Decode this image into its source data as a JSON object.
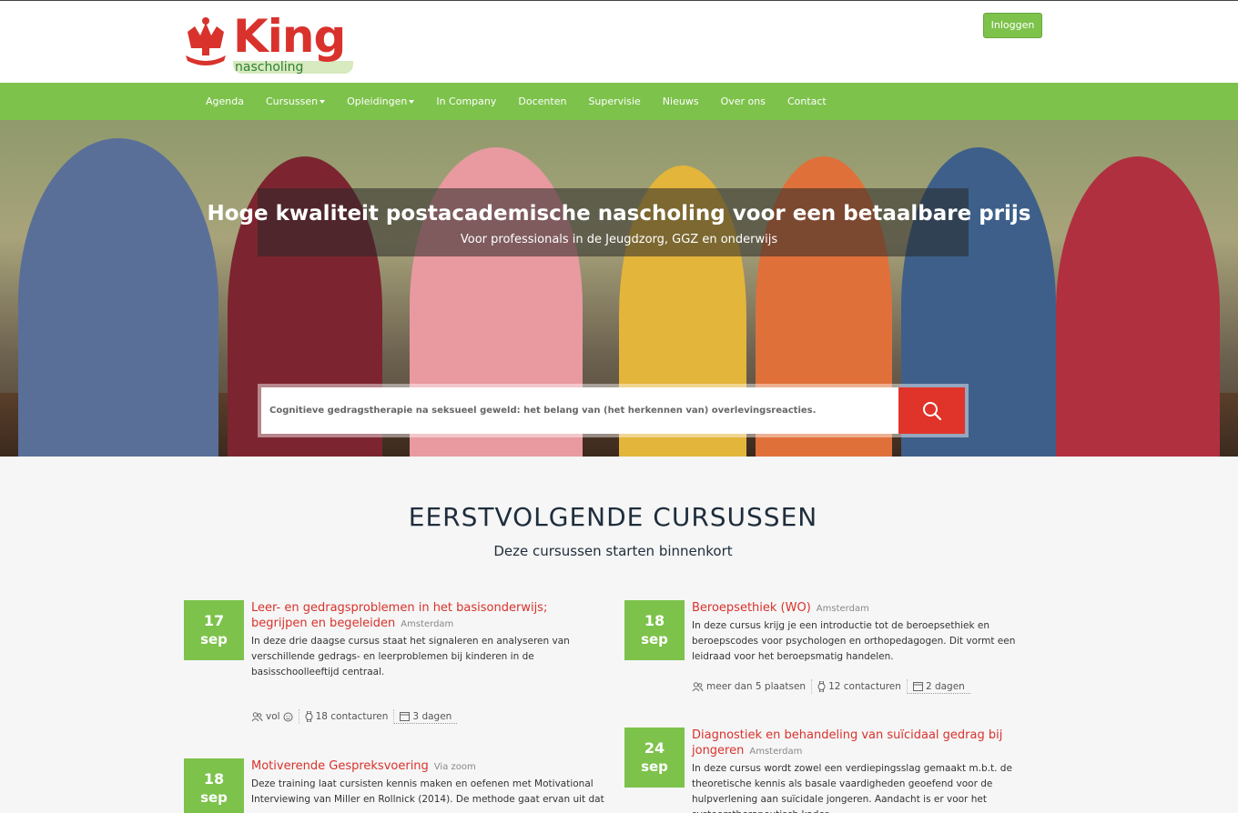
{
  "header": {
    "logo_word": "King",
    "logo_sub": "nascholing",
    "login_label": "Inloggen"
  },
  "nav": {
    "items": [
      "Agenda",
      "Cursussen",
      "Opleidingen",
      "In Company",
      "Docenten",
      "Supervisie",
      "Nieuws",
      "Over ons",
      "Contact"
    ]
  },
  "hero": {
    "title": "Hoge kwaliteit postacademische nascholing voor een betaalbare prijs",
    "subtitle": "Voor professionals in de Jeugdzorg, GGZ en onderwijs",
    "search_value": "Cognitieve gedragstherapie na seksueel geweld: het belang van (het herkennen van) overlevingsreacties."
  },
  "section": {
    "title": "EERSTVOLGENDE CURSUSSEN",
    "subtitle": "Deze cursussen starten binnenkort"
  },
  "courses": [
    {
      "day": "17",
      "month": "sep",
      "title": "Leer- en gedragsproblemen in het basisonderwijs; begrijpen en begeleiden",
      "location": "Amsterdam",
      "description": "In deze drie daagse cursus staat het signaleren en analyseren van verschillende gedrags- en leerproblemen bij kinderen in de basisschoolleeftijd centraal.",
      "seats": "vol",
      "hours": "18 contacturen",
      "days": "3 dagen"
    },
    {
      "day": "18",
      "month": "sep",
      "title": "Beroepsethiek (WO)",
      "location": "Amsterdam",
      "description": "In deze cursus krijg je een introductie tot de beroepsethiek en beroepscodes voor psychologen en orthopedagogen. Dit vormt een leidraad voor het beroepsmatig handelen.",
      "seats": "meer dan 5 plaatsen",
      "hours": "12 contacturen",
      "days": "2 dagen"
    },
    {
      "day": "18",
      "month": "sep",
      "title": "Motiverende Gespreksvoering",
      "location": "Via zoom",
      "description": "Deze training laat cursisten kennis maken en oefenen met Motivational Interviewing van Miller en Rollnick (2014). De methode gaat ervan uit dat"
    },
    {
      "day": "24",
      "month": "sep",
      "title": "Diagnostiek en behandeling van suïcidaal gedrag bij jongeren",
      "location": "Amsterdam",
      "description": "In deze cursus wordt zowel een verdiepingsslag gemaakt m.b.t. de theoretische kennis als basale vaardigheden geoefend voor de hulpverlening aan suïcidale jongeren. Aandacht is er voor het systeemtherapeutisch kader"
    }
  ],
  "colors": {
    "brand_green": "#7dc24b",
    "brand_red": "#d9322d",
    "search_red": "#e0342a"
  }
}
